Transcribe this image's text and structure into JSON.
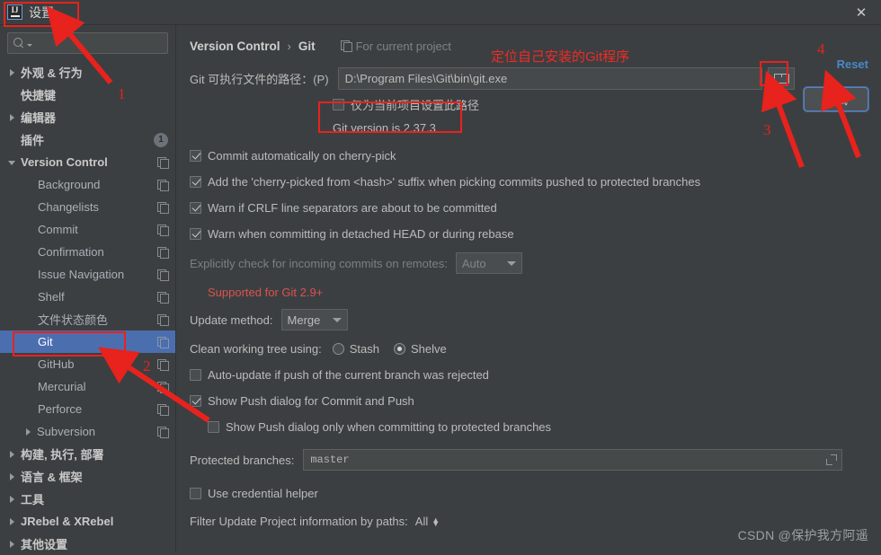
{
  "window": {
    "title": "设置",
    "logo_text": "IJ",
    "close_label": "✕"
  },
  "sidebar": {
    "search_placeholder": "",
    "items": [
      {
        "label": "外观 & 行为",
        "level": 0,
        "arrow": "closed",
        "icon": "",
        "badge": ""
      },
      {
        "label": "快捷键",
        "level": 0,
        "arrow": "none",
        "icon": "",
        "badge": ""
      },
      {
        "label": "编辑器",
        "level": 0,
        "arrow": "closed",
        "icon": "",
        "badge": ""
      },
      {
        "label": "插件",
        "level": 0,
        "arrow": "none",
        "icon": "",
        "badge": "1"
      },
      {
        "label": "Version Control",
        "level": 0,
        "arrow": "open",
        "icon": "copy-icon",
        "badge": ""
      },
      {
        "label": "Background",
        "level": 1,
        "arrow": "none",
        "icon": "copy-icon",
        "badge": ""
      },
      {
        "label": "Changelists",
        "level": 1,
        "arrow": "none",
        "icon": "copy-icon",
        "badge": ""
      },
      {
        "label": "Commit",
        "level": 1,
        "arrow": "none",
        "icon": "copy-icon",
        "badge": ""
      },
      {
        "label": "Confirmation",
        "level": 1,
        "arrow": "none",
        "icon": "copy-icon",
        "badge": ""
      },
      {
        "label": "Issue Navigation",
        "level": 1,
        "arrow": "none",
        "icon": "copy-icon",
        "badge": ""
      },
      {
        "label": "Shelf",
        "level": 1,
        "arrow": "none",
        "icon": "copy-icon",
        "badge": ""
      },
      {
        "label": "文件状态颜色",
        "level": 1,
        "arrow": "none",
        "icon": "copy-icon",
        "badge": ""
      },
      {
        "label": "Git",
        "level": 1,
        "arrow": "none",
        "icon": "copy-icon",
        "badge": "",
        "selected": true
      },
      {
        "label": "GitHub",
        "level": 1,
        "arrow": "none",
        "icon": "copy-icon",
        "badge": ""
      },
      {
        "label": "Mercurial",
        "level": 1,
        "arrow": "none",
        "icon": "copy-icon",
        "badge": ""
      },
      {
        "label": "Perforce",
        "level": 1,
        "arrow": "none",
        "icon": "copy-icon",
        "badge": ""
      },
      {
        "label": "Subversion",
        "level": 1,
        "arrow": "closed",
        "icon": "copy-icon",
        "badge": ""
      },
      {
        "label": "构建, 执行, 部署",
        "level": 0,
        "arrow": "closed",
        "icon": "",
        "badge": ""
      },
      {
        "label": "语言 & 框架",
        "level": 0,
        "arrow": "closed",
        "icon": "",
        "badge": ""
      },
      {
        "label": "工具",
        "level": 0,
        "arrow": "closed",
        "icon": "",
        "badge": ""
      },
      {
        "label": "JRebel & XRebel",
        "level": 0,
        "arrow": "closed",
        "icon": "",
        "badge": ""
      },
      {
        "label": "其他设置",
        "level": 0,
        "arrow": "closed",
        "icon": "",
        "badge": ""
      }
    ]
  },
  "main": {
    "breadcrumb_root": "Version Control",
    "breadcrumb_sep": "›",
    "breadcrumb_current": "Git",
    "for_current_project": "For current project",
    "reset_label": "Reset",
    "test_button_label": "测试",
    "path_label": "Git 可执行文件的路径：(P)",
    "path_value": "D:\\Program Files\\Git\\bin\\git.exe",
    "project_only_checkbox": "仅为当前项目设置此路径",
    "git_version_text": "Git version is 2.37.3",
    "checkboxes": [
      {
        "label": "Commit automatically on cherry-pick",
        "checked": true,
        "disabled": false
      },
      {
        "label": "Add the 'cherry-picked from <hash>' suffix when picking commits pushed to protected branches",
        "checked": true,
        "disabled": false
      },
      {
        "label": "Warn if CRLF line separators are about to be committed",
        "checked": true,
        "disabled": false
      },
      {
        "label": "Warn when committing in detached HEAD or during rebase",
        "checked": true,
        "disabled": false
      }
    ],
    "explicit_check_label": "Explicitly check for incoming commits on remotes:",
    "explicit_check_value": "Auto",
    "supported_note": "Supported for Git 2.9+",
    "update_method_label": "Update method:",
    "update_method_value": "Merge",
    "clean_tree_label": "Clean working tree using:",
    "clean_tree_options": [
      {
        "label": "Stash",
        "selected": false
      },
      {
        "label": "Shelve",
        "selected": true
      }
    ],
    "auto_update_label": "Auto-update if push of the current branch was rejected",
    "auto_update_checked": false,
    "show_push_label": "Show Push dialog for Commit and Push",
    "show_push_checked": true,
    "show_push_protected_label": "Show Push dialog only when committing to protected branches",
    "show_push_protected_checked": false,
    "protected_branches_label": "Protected branches:",
    "protected_branches_value": "master",
    "credential_helper_label": "Use credential helper",
    "credential_helper_checked": false,
    "filter_label": "Filter Update Project information by paths:",
    "filter_value": "All"
  },
  "annotations": {
    "num1": "1",
    "num2": "2",
    "num3": "3",
    "num4": "4",
    "locate_git_text": "定位自己安装的Git程序"
  },
  "watermark": "CSDN @保护我方阿遥",
  "colors": {
    "background": "#3c3f41",
    "selection": "#4b6eaf",
    "accent_red": "#e8221d",
    "link_blue": "#4a88c7",
    "note_red": "#d9534f"
  }
}
